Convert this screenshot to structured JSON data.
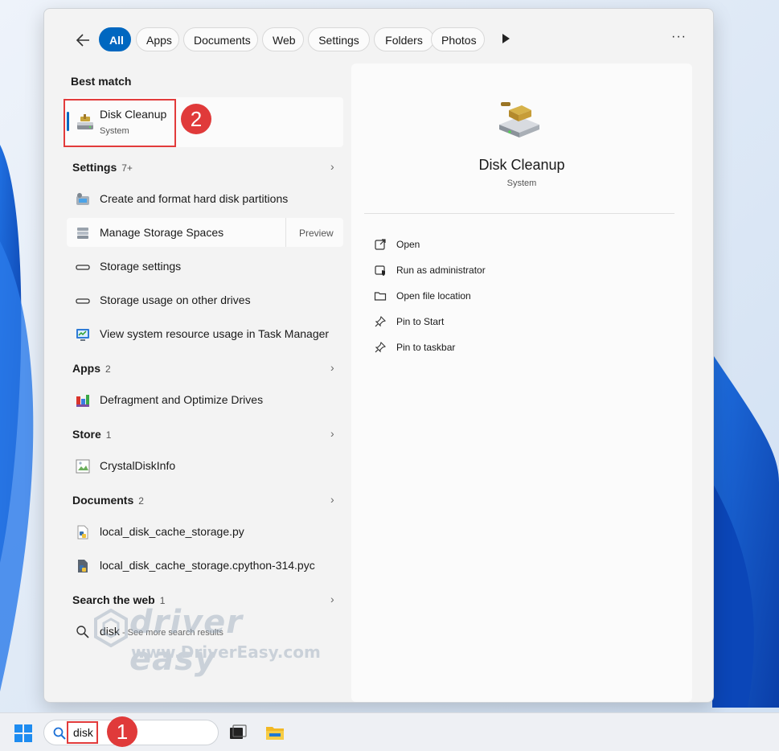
{
  "filters": {
    "tabs": [
      "All",
      "Apps",
      "Documents",
      "Web",
      "Settings",
      "Folders",
      "Photos"
    ],
    "active": "All",
    "more_label": "···"
  },
  "best_match": {
    "heading": "Best match",
    "name": "Disk Cleanup",
    "type": "System",
    "callout": "2"
  },
  "settings": {
    "heading": "Settings",
    "count": "7+",
    "items": [
      "Create and format hard disk partitions",
      "Manage Storage Spaces",
      "Storage settings",
      "Storage usage on other drives",
      "View system resource usage in Task Manager"
    ],
    "preview_label": "Preview"
  },
  "apps": {
    "heading": "Apps",
    "count": "2",
    "items": [
      "Defragment and Optimize Drives"
    ]
  },
  "store": {
    "heading": "Store",
    "count": "1",
    "items": [
      "CrystalDiskInfo"
    ]
  },
  "documents": {
    "heading": "Documents",
    "count": "2",
    "items": [
      "local_disk_cache_storage.py",
      "local_disk_cache_storage.cpython-314.pyc"
    ]
  },
  "web": {
    "heading": "Search the web",
    "count": "1",
    "query": "disk",
    "hint": " - See more search results"
  },
  "detail": {
    "title": "Disk Cleanup",
    "subtitle": "System",
    "actions": [
      "Open",
      "Run as administrator",
      "Open file location",
      "Pin to Start",
      "Pin to taskbar"
    ]
  },
  "watermark": {
    "brand": "driver easy",
    "url": "www.DriverEasy.com"
  },
  "taskbar": {
    "search_value": "disk",
    "callout": "1"
  },
  "colors": {
    "accent": "#0067c0",
    "callout": "#e03a3a"
  }
}
